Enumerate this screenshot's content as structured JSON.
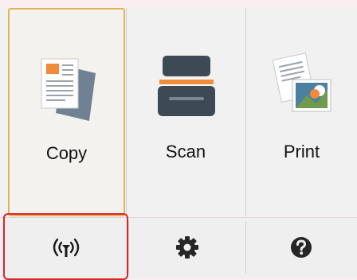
{
  "tiles": [
    {
      "label": "Copy",
      "icon": "copy-document-icon",
      "selected": true
    },
    {
      "label": "Scan",
      "icon": "scanner-icon",
      "selected": false
    },
    {
      "label": "Print",
      "icon": "photo-print-icon",
      "selected": false
    }
  ],
  "bottom_bar": [
    {
      "icon": "wireless-antenna-icon",
      "highlighted": true
    },
    {
      "icon": "gear-icon",
      "highlighted": false
    },
    {
      "icon": "help-question-icon",
      "highlighted": false
    }
  ],
  "colors": {
    "selection_border": "#e2b45a",
    "highlight_red": "#d9262b",
    "panel_bg": "#f1f1f1",
    "top_strip": "#fbeef0"
  }
}
